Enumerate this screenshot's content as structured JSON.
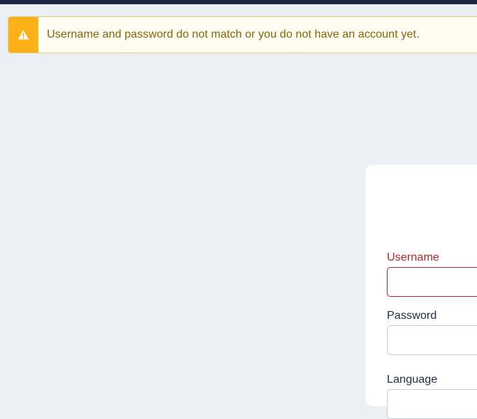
{
  "alert": {
    "icon": "warning-triangle-icon",
    "message": "Username and password do not match or you do not have an account yet."
  },
  "login_form": {
    "username_label": "Username",
    "username_value": "",
    "password_label": "Password",
    "password_value": "",
    "language_label": "Language"
  },
  "colors": {
    "top_bar": "#1c2a46",
    "page_background": "#ebf0f5",
    "alert_accent": "#fdb119",
    "alert_background": "#fffcf1",
    "alert_text": "#8a6508",
    "error": "#b4272b",
    "label_text": "#1d2c4a"
  }
}
